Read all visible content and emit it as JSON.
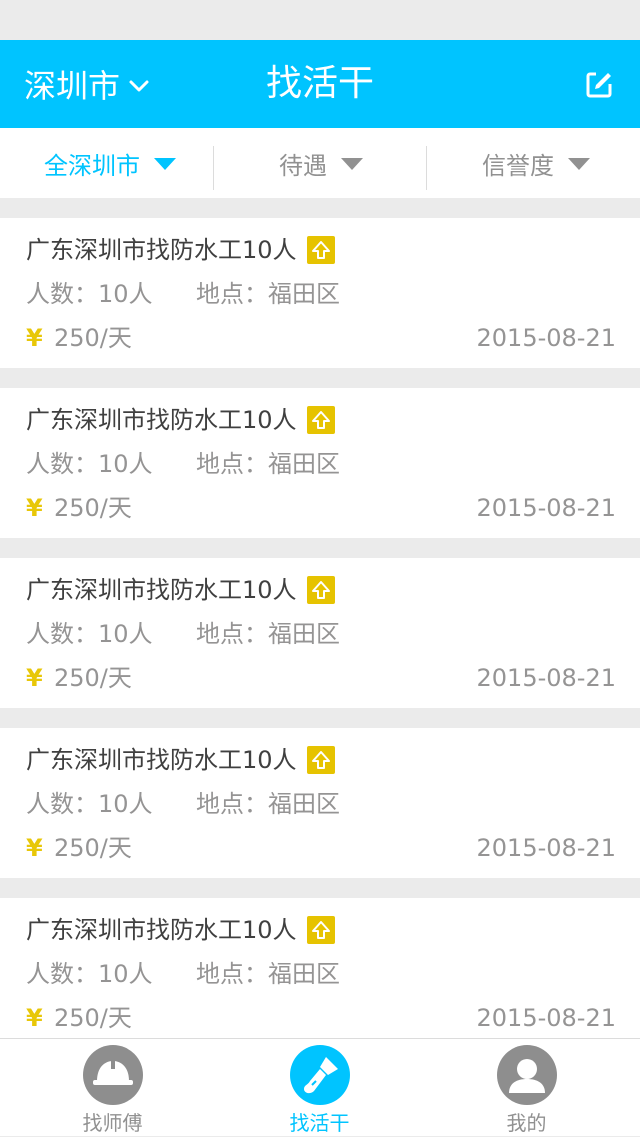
{
  "header": {
    "city": "深圳市",
    "title": "找活干",
    "bg_color": "#00c4ff",
    "icons": [
      "chevron-down-icon",
      "edit-icon"
    ]
  },
  "filters": [
    {
      "label": "全深圳市",
      "active": true
    },
    {
      "label": "待遇",
      "active": false
    },
    {
      "label": "信誉度",
      "active": false
    }
  ],
  "jobs": [
    {
      "name": "广东深圳市找防水工10人",
      "people": "人数：10人",
      "place": "地点：福田区",
      "yuan": "¥",
      "wage": "250/天",
      "date": "2015-08-21"
    },
    {
      "name": "广东深圳市找防水工10人",
      "people": "人数：10人",
      "place": "地点：福田区",
      "yuan": "¥",
      "wage": "250/天",
      "date": "2015-08-21"
    },
    {
      "name": "广东深圳市找防水工10人",
      "people": "人数：10人",
      "place": "地点：福田区",
      "yuan": "¥",
      "wage": "250/天",
      "date": "2015-08-21"
    },
    {
      "name": "广东深圳市找防水工10人",
      "people": "人数：10人",
      "place": "地点：福田区",
      "yuan": "¥",
      "wage": "250/天",
      "date": "2015-08-21"
    },
    {
      "name": "广东深圳市找防水工10人",
      "people": "人数：10人",
      "place": "地点：福田区",
      "yuan": "¥",
      "wage": "250/天",
      "date": "2015-08-21"
    }
  ],
  "badge": {
    "icon": "up-arrow-badge-icon",
    "color": "#e6c300"
  },
  "tabs": [
    {
      "label": "找师傅",
      "icon": "hard-hat-icon",
      "active": false
    },
    {
      "label": "找活干",
      "icon": "brush-icon",
      "active": true
    },
    {
      "label": "我的",
      "icon": "user-icon",
      "active": false
    }
  ],
  "colors": {
    "accent": "#00c4ff",
    "yuan": "#e8c708",
    "text_dark": "#404040",
    "text_light": "#959494",
    "filter_text": "#919191"
  }
}
